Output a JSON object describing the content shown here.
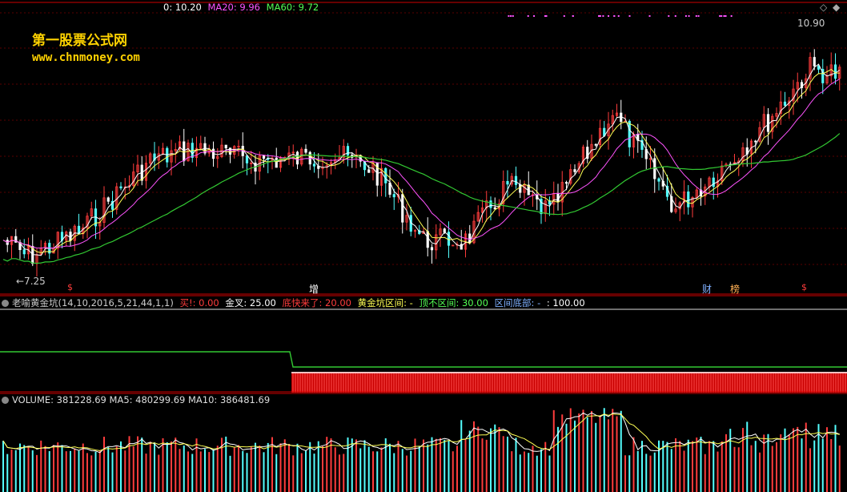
{
  "main": {
    "hdr": {
      "price": "0: 10.20",
      "ma20": "MA20: 9.96",
      "ma60": "MA60: 9.72"
    },
    "watermark": {
      "line1": "第一股票公式网",
      "line2": "www.chnmoney.com"
    },
    "price_high": "10.90",
    "price_low": "←7.25",
    "markers": {
      "s1": "$",
      "zeng": "增",
      "cai": "财",
      "bang": "榜",
      "s2": "$"
    }
  },
  "indicator": {
    "name": "老喻黄金坑(14,10,2016,5,21,44,1,1)",
    "buy": "买!",
    "buy_val": ": 0.00",
    "cross": "金叉: 25.00",
    "bottom_fast": "底快来了: 20.00",
    "pit_range": "黄金坑区间: -",
    "top_range": "顶不区间: 30.00",
    "bottom_part": "区间底部: -",
    "last_val": ": 100.00"
  },
  "volume": {
    "hdr": "VOLUME: 381228.69  MA5: 480299.69  MA10: 386481.69"
  },
  "colors": {
    "up": "#ff3c3c",
    "down": "#54ffff",
    "ma20": "#ff54ff",
    "ma60": "#32c832",
    "fast": "#ffffff",
    "mid": "#ffff54",
    "grid": "#5a0000"
  }
}
